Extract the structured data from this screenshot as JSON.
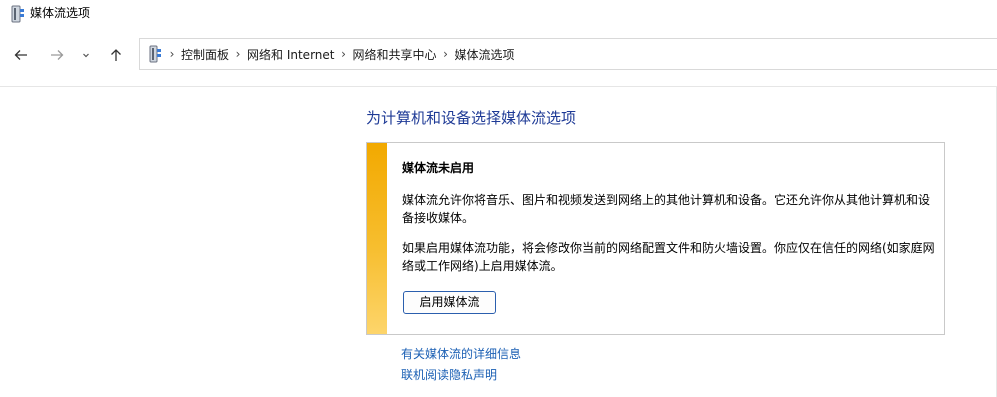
{
  "window": {
    "title": "媒体流选项",
    "icon": "media-streaming-icon"
  },
  "nav": {
    "back_icon": "arrow-left-icon",
    "forward_icon": "arrow-right-icon",
    "history_icon": "chevron-down-icon",
    "up_icon": "arrow-up-icon"
  },
  "address": {
    "icon": "control-panel-icon",
    "separator": "›",
    "crumbs": [
      "控制面板",
      "网络和 Internet",
      "网络和共享中心",
      "媒体流选项"
    ]
  },
  "main": {
    "heading": "为计算机和设备选择媒体流选项",
    "panel": {
      "title": "媒体流未启用",
      "paragraph1": "媒体流允许你将音乐、图片和视频发送到网络上的其他计算机和设备。它还允许你从其他计算机和设备接收媒体。",
      "paragraph2": "如果启用媒体流功能，将会修改你当前的网络配置文件和防火墙设置。你应仅在信任的网络(如家庭网络或工作网络)上启用媒体流。",
      "enable_button": "启用媒体流",
      "accent_color": "#f2a900"
    },
    "links": [
      "有关媒体流的详细信息",
      "联机阅读隐私声明"
    ],
    "heading_color": "#1e3a96",
    "link_color": "#1a5fb4"
  }
}
